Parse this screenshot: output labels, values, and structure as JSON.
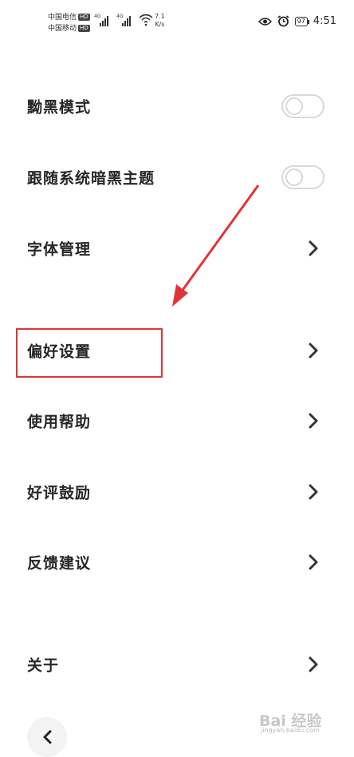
{
  "statusbar": {
    "carrier1": "中国电信",
    "carrier2": "中国移动",
    "hd": "HD",
    "net1": "4G",
    "net2": "4G",
    "speed_value": "7.1",
    "speed_unit": "K/s",
    "battery": "97",
    "time": "4:51"
  },
  "settings": {
    "dark_mode": "黝黑模式",
    "follow_system": "跟随系统暗黑主题",
    "font_manage": "字体管理",
    "preferences": "偏好设置",
    "help": "使用帮助",
    "rate": "好评鼓励",
    "feedback": "反馈建议",
    "about": "关于"
  },
  "toggles": {
    "dark_mode_on": false,
    "follow_system_on": false
  },
  "watermark": {
    "text": "Bai 经验",
    "url": "jingyan.baidu.com"
  },
  "colors": {
    "highlight": "#e0343a",
    "toggle_border": "#d8d8d8"
  }
}
